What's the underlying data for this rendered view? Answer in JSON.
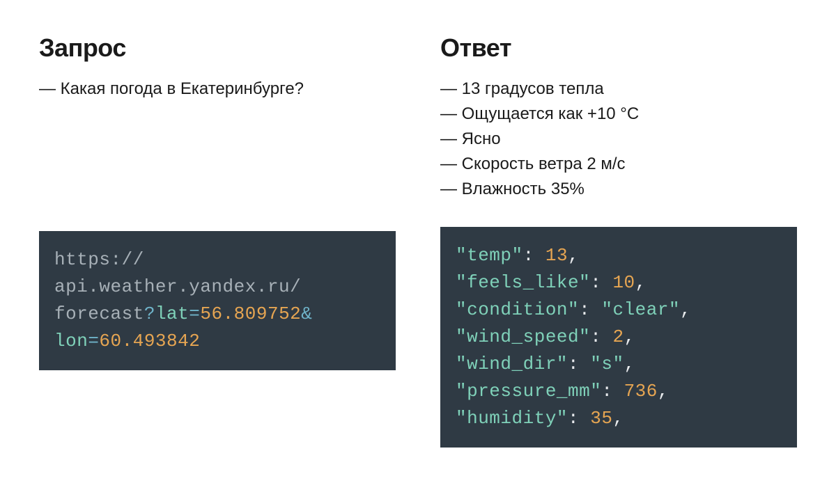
{
  "left": {
    "heading": "Запрос",
    "items": [
      "— Какая погода в Екатеринбурге?"
    ],
    "code": {
      "protocol": "https://",
      "host": "api.weather.yandex.ru/",
      "path": "forecast",
      "qmark": "?",
      "param1_key": "lat",
      "eq1": "=",
      "param1_val": "56.809752",
      "amp": "&",
      "param2_key": "lon",
      "eq2": "=",
      "param2_val": "60.493842"
    }
  },
  "right": {
    "heading": "Ответ",
    "items": [
      "— 13 градусов тепла",
      "— Ощущается как +10 °C",
      "— Ясно",
      "— Скорость ветра 2 м/с",
      "— Влажность 35%"
    ],
    "code": [
      {
        "key": "\"temp\"",
        "colon": ": ",
        "val": "13",
        "comma": ",",
        "valClass": "c-orange"
      },
      {
        "key": "\"feels_like\"",
        "colon": ": ",
        "val": "10",
        "comma": ",",
        "valClass": "c-orange"
      },
      {
        "key": "\"condition\"",
        "colon": ": ",
        "val": "\"clear\"",
        "comma": ",",
        "valClass": "c-green"
      },
      {
        "key": "\"wind_speed\"",
        "colon": ": ",
        "val": "2",
        "comma": ",",
        "valClass": "c-orange"
      },
      {
        "key": "\"wind_dir\"",
        "colon": ": ",
        "val": "\"s\"",
        "comma": ",",
        "valClass": "c-green"
      },
      {
        "key": "\"pressure_mm\"",
        "colon": ": ",
        "val": "736",
        "comma": ",",
        "valClass": "c-orange"
      },
      {
        "key": "\"humidity\"",
        "colon": ": ",
        "val": "35",
        "comma": ",",
        "valClass": "c-orange"
      }
    ]
  }
}
